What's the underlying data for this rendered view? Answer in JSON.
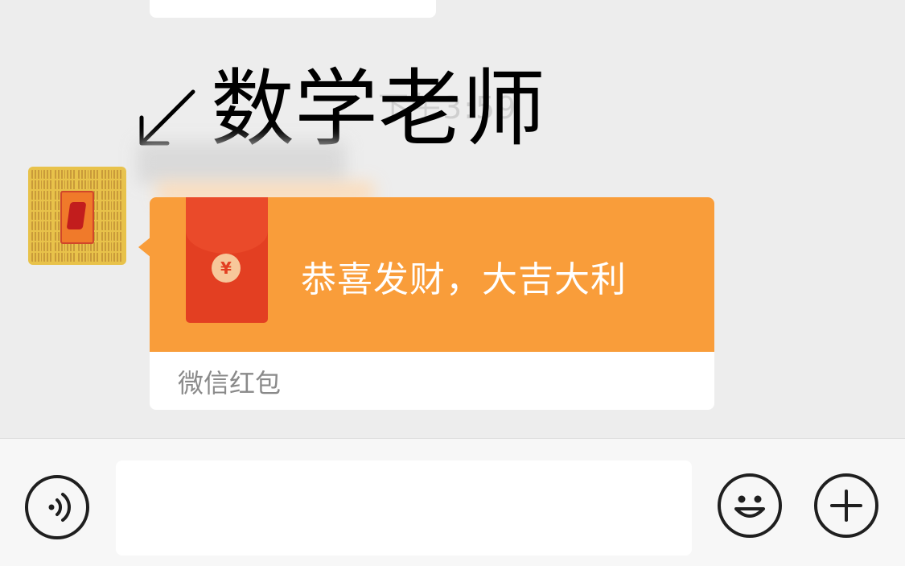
{
  "chat": {
    "timestamp": "下午3:59",
    "annotation": "数学老师",
    "annotation_arrow": "↙"
  },
  "red_packet": {
    "greeting": "恭喜发财，大吉大利",
    "footer_label": "微信红包",
    "coin_symbol": "¥",
    "color_top": "#f99d3a",
    "color_envelope": "#e33f22"
  },
  "input_bar": {
    "voice_icon": "voice-icon",
    "message_value": "",
    "emoji_icon": "emoji-icon",
    "plus_icon": "plus-icon"
  }
}
